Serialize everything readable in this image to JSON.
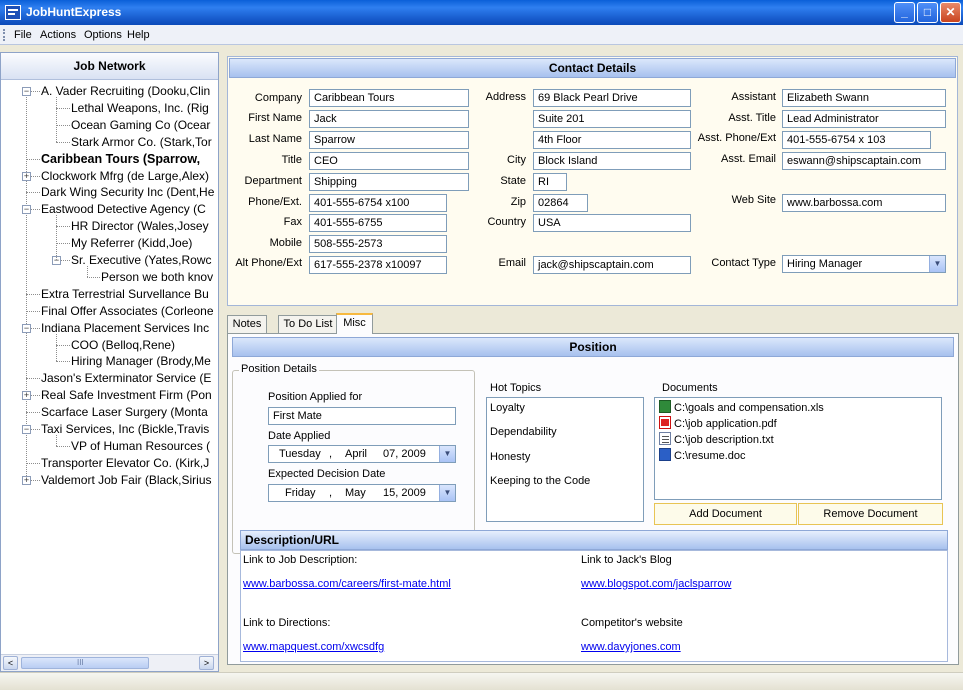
{
  "window": {
    "title": "JobHuntExpress",
    "buttons": {
      "minimize": "_",
      "maximize": "□",
      "close": "✕"
    }
  },
  "menu": [
    "File",
    "Actions",
    "Options",
    "Help"
  ],
  "job_network": {
    "title": "Job Network",
    "tree": [
      {
        "label": "A. Vader Recruiting (Dooku,Clin",
        "level": 0,
        "expander": "−"
      },
      {
        "label": "Lethal Weapons, Inc. (Rig",
        "level": 1
      },
      {
        "label": "Ocean Gaming Co (Ocear",
        "level": 1
      },
      {
        "label": "Stark Armor Co. (Stark,Tor",
        "level": 1
      },
      {
        "label": "Caribbean Tours (Sparrow,",
        "level": 0,
        "selected": true
      },
      {
        "label": "Clockwork Mfrg (de Large,Alex)",
        "level": 0,
        "expander": "+"
      },
      {
        "label": "Dark Wing Security Inc (Dent,He",
        "level": 0
      },
      {
        "label": "Eastwood Detective Agency (C",
        "level": 0,
        "expander": "−"
      },
      {
        "label": "HR Director (Wales,Josey",
        "level": 1
      },
      {
        "label": "My Referrer (Kidd,Joe)",
        "level": 1
      },
      {
        "label": "Sr. Executive (Yates,Rowc",
        "level": 1,
        "expander": "−"
      },
      {
        "label": "Person we both knov",
        "level": 2
      },
      {
        "label": "Extra Terrestrial Survellance Bu",
        "level": 0
      },
      {
        "label": "Final Offer Associates (Corleone",
        "level": 0
      },
      {
        "label": "Indiana Placement Services Inc",
        "level": 0,
        "expander": "−"
      },
      {
        "label": "COO (Belloq,Rene)",
        "level": 1
      },
      {
        "label": "Hiring Manager (Brody,Me",
        "level": 1
      },
      {
        "label": "Jason's Exterminator Service (E",
        "level": 0
      },
      {
        "label": "Real Safe Investment Firm (Pon",
        "level": 0,
        "expander": "+"
      },
      {
        "label": "Scarface Laser Surgery (Monta",
        "level": 0
      },
      {
        "label": "Taxi Services, Inc (Bickle,Travis",
        "level": 0,
        "expander": "−"
      },
      {
        "label": "VP of Human Resources (",
        "level": 1
      },
      {
        "label": "Transporter Elevator Co. (Kirk,J",
        "level": 0
      },
      {
        "label": "Valdemort Job Fair (Black,Sirius",
        "level": 0,
        "expander": "+"
      }
    ],
    "scroll": {
      "left": "<",
      "right": ">",
      "grip": "III"
    }
  },
  "contact": {
    "title": "Contact Details",
    "labels": {
      "company": "Company",
      "first_name": "First Name",
      "last_name": "Last Name",
      "title": "Title",
      "department": "Department",
      "phone": "Phone/Ext.",
      "fax": "Fax",
      "mobile": "Mobile",
      "alt_phone": "Alt Phone/Ext",
      "address": "Address",
      "city": "City",
      "state": "State",
      "zip": "Zip",
      "country": "Country",
      "email": "Email",
      "assistant": "Assistant",
      "asst_title": "Asst. Title",
      "asst_phone": "Asst. Phone/Ext",
      "asst_email": "Asst. Email",
      "web_site": "Web Site",
      "contact_type": "Contact Type"
    },
    "values": {
      "company": "Caribbean Tours",
      "first_name": "Jack",
      "last_name": "Sparrow",
      "title": "CEO",
      "department": "Shipping",
      "phone": "401-555-6754 x100",
      "fax": "401-555-6755",
      "mobile": "508-555-2573",
      "alt_phone": "617-555-2378 x10097",
      "address1": "69 Black Pearl Drive",
      "address2": "Suite 201",
      "address3": "4th Floor",
      "city": "Block Island",
      "state": "RI",
      "zip": "02864",
      "country": "USA",
      "email": "jack@shipscaptain.com",
      "assistant": "Elizabeth Swann",
      "asst_title": "Lead Administrator",
      "asst_phone": "401-555-6754 x 103",
      "asst_email": "eswann@shipscaptain.com",
      "web_site": "www.barbossa.com",
      "contact_type": "Hiring Manager"
    }
  },
  "tabs": [
    {
      "label": "Notes",
      "active": false
    },
    {
      "label": "To Do List",
      "active": false
    },
    {
      "label": "Misc",
      "active": true
    }
  ],
  "position": {
    "title": "Position",
    "details_group": "Position Details",
    "applied_for_label": "Position Applied for",
    "applied_for": "First Mate",
    "date_applied_label": "Date Applied",
    "date_applied": {
      "weekday": "Tuesday",
      "month": "April",
      "day": "07, 2009"
    },
    "decision_label": "Expected Decision Date",
    "decision_date": {
      "weekday": "Friday",
      "month": "May",
      "day": "15, 2009"
    },
    "hot_topics_group": "Hot Topics",
    "hot_topics": [
      "Loyalty",
      "Dependability",
      "Honesty",
      "Keeping to the Code"
    ],
    "documents_group": "Documents",
    "documents": [
      {
        "name": "C:\\goals and compensation.xls",
        "icon": "excel-file-icon"
      },
      {
        "name": "C:\\job application.pdf",
        "icon": "pdf-file-icon"
      },
      {
        "name": "C:\\job description.txt",
        "icon": "text-file-icon"
      },
      {
        "name": "C:\\resume.doc",
        "icon": "word-file-icon"
      }
    ],
    "add_document": "Add Document",
    "remove_document": "Remove Document",
    "desc_title": "Description/URL",
    "links": {
      "job_desc_label": "Link to Job Description:",
      "job_desc_url": "www.barbossa.com/careers/first-mate.html",
      "blog_label": "Link to Jack's Blog",
      "blog_url": "www.blogspot.com/jaclsparrow",
      "directions_label": "Link to Directions:",
      "directions_url": "www.mapquest.com/xwcsdfg",
      "competitor_label": "Competitor's website",
      "competitor_url": "www.davyjones.com"
    }
  },
  "colors": {
    "titlebar": "#0a5fd8",
    "header_bar": "#a7c1ee",
    "link": "#0000ee",
    "tab_active_border": "#f7b940"
  }
}
